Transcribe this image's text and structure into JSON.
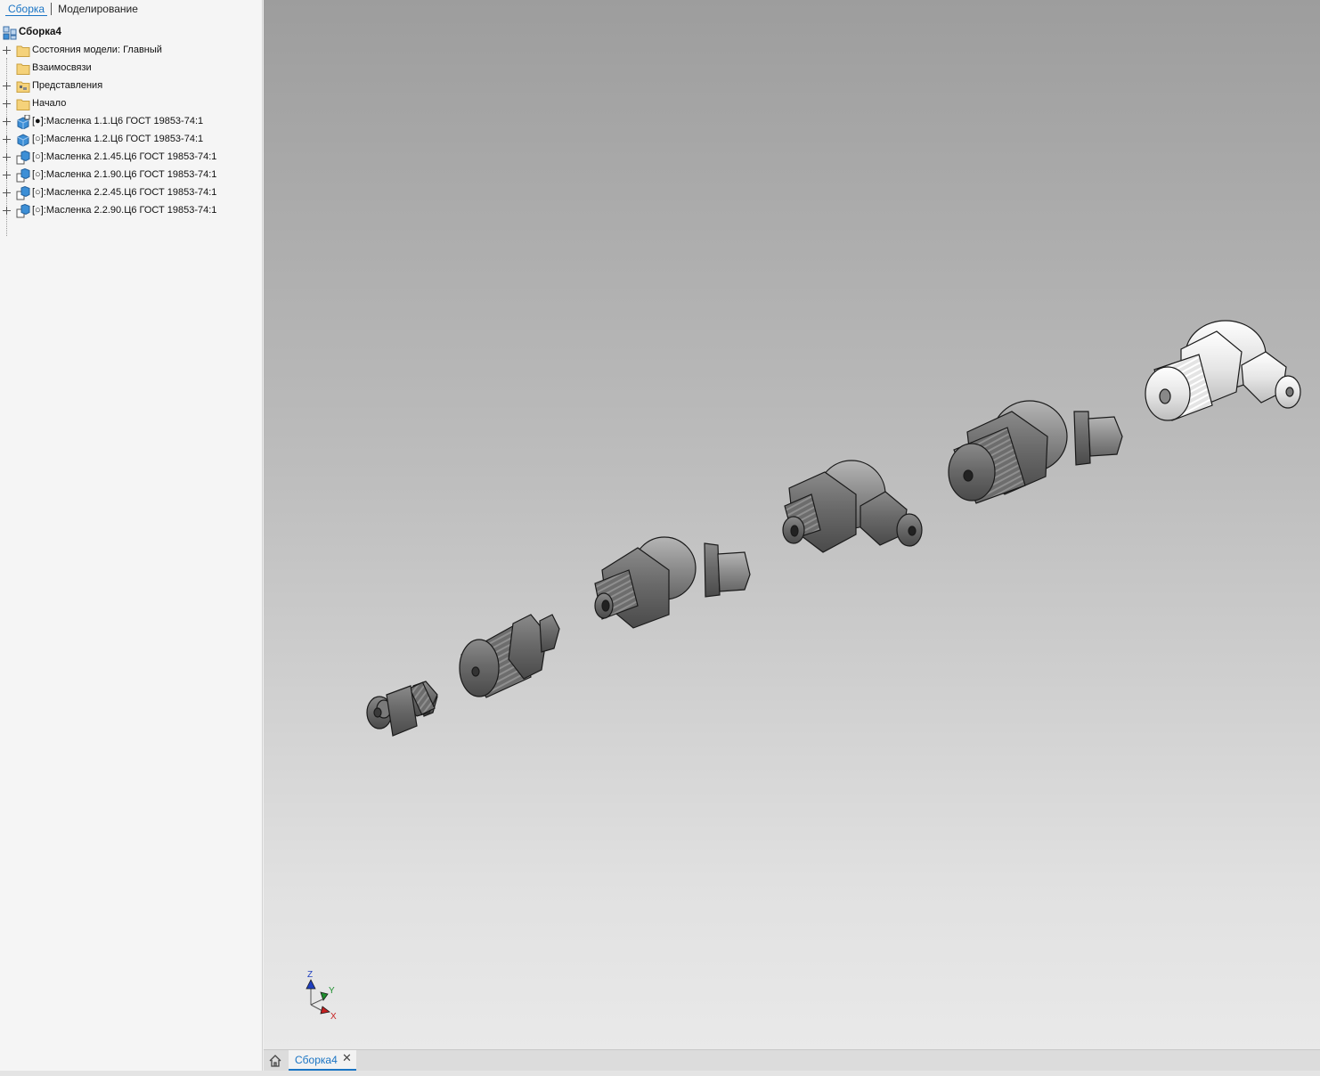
{
  "sidebar": {
    "tabs": [
      {
        "label": "Сборка"
      },
      {
        "label": "Моделирование"
      }
    ],
    "root": {
      "label": "Сборка4"
    },
    "items": [
      {
        "label": "Состояния модели: Главный",
        "icon": "folder-icon",
        "expandable": true
      },
      {
        "label": "Взаимосвязи",
        "icon": "folder-icon",
        "expandable": false
      },
      {
        "label": "Представления",
        "icon": "representations-folder-icon",
        "expandable": true
      },
      {
        "label": "Начало",
        "icon": "folder-icon",
        "expandable": true
      },
      {
        "label": "[●]:Масленка 1.1.Ц6 ГОСТ 19853-74:1",
        "icon": "part-edit-icon",
        "expandable": true
      },
      {
        "label": "[○]:Масленка 1.2.Ц6 ГОСТ 19853-74:1",
        "icon": "part-icon",
        "expandable": true
      },
      {
        "label": "[○]:Масленка 2.1.45.Ц6 ГОСТ 19853-74:1",
        "icon": "subassembly-icon",
        "expandable": true
      },
      {
        "label": "[○]:Масленка 2.1.90.Ц6 ГОСТ 19853-74:1",
        "icon": "subassembly-icon",
        "expandable": true
      },
      {
        "label": "[○]:Масленка 2.2.45.Ц6 ГОСТ 19853-74:1",
        "icon": "subassembly-icon",
        "expandable": true
      },
      {
        "label": "[○]:Масленка 2.2.90.Ц6 ГОСТ 19853-74:1",
        "icon": "subassembly-icon",
        "expandable": true
      }
    ]
  },
  "viewport": {
    "triad": {
      "z_label": "Z",
      "y_label": "Y",
      "x_label": "X"
    }
  },
  "doc_tabs": {
    "home_icon": "home-icon",
    "active_tab": {
      "label": "Сборка4",
      "close": "✕"
    }
  },
  "colors": {
    "accent": "#1a74c4",
    "folder": "#f5d27a",
    "part_blue": "#3d8fd6",
    "triad_z": "#1f3fbf",
    "triad_y": "#1f8f2f",
    "triad_x": "#c62020"
  }
}
